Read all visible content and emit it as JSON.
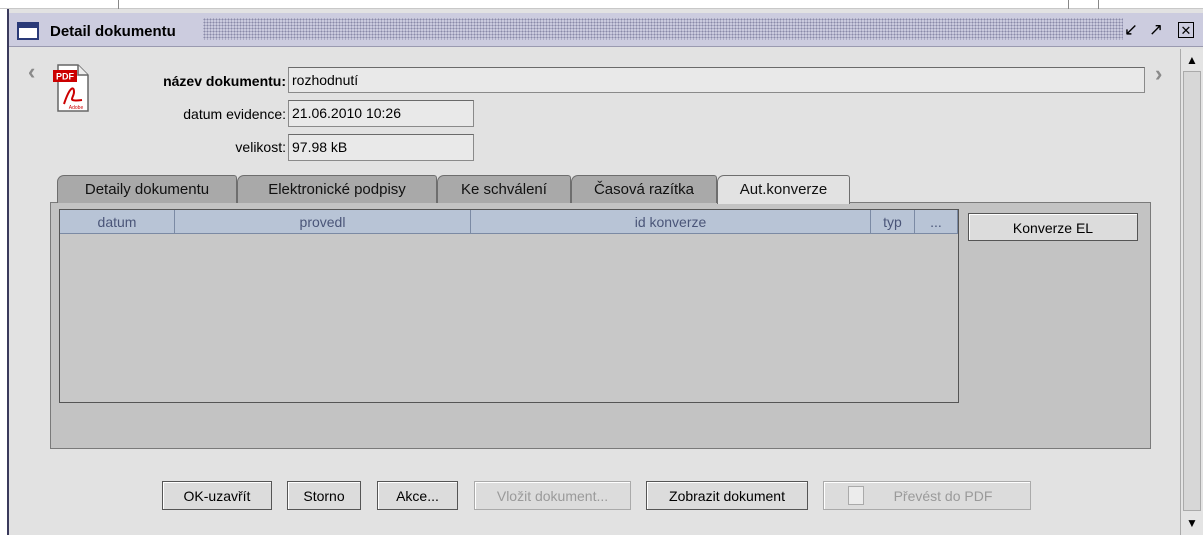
{
  "window": {
    "title": "Detail dokumentu"
  },
  "doc_icon": {
    "badge": "PDF",
    "brand": "Adobe"
  },
  "fields": [
    {
      "label": "název dokumentu:",
      "value": "rozhodnutí"
    },
    {
      "label": "datum evidence:",
      "value": "21.06.2010 10:26"
    },
    {
      "label": "velikost:",
      "value": "97.98 kB"
    }
  ],
  "tabs": [
    {
      "label": "Detaily dokumentu",
      "active": false
    },
    {
      "label": "Elektronické podpisy",
      "active": false
    },
    {
      "label": "Ke schválení",
      "active": false
    },
    {
      "label": "Časová razítka",
      "active": false
    },
    {
      "label": "Aut.konverze",
      "active": true
    }
  ],
  "grid": {
    "columns": [
      "datum",
      "provedl",
      "id konverze",
      "typ",
      "..."
    ],
    "rows": []
  },
  "side_button": "Konverze EL",
  "buttons": [
    {
      "label": "OK-uzavřít",
      "enabled": true
    },
    {
      "label": "Storno",
      "enabled": true
    },
    {
      "label": "Akce...",
      "enabled": true
    },
    {
      "label": "Vložit dokument...",
      "enabled": false
    },
    {
      "label": "Zobrazit dokument",
      "enabled": true
    },
    {
      "label": "Převést do PDF",
      "enabled": false
    }
  ],
  "colors": {
    "titlebar": "#ccccdf",
    "column_header": "#b8c4d6",
    "pdf_red": "#cc0000"
  }
}
